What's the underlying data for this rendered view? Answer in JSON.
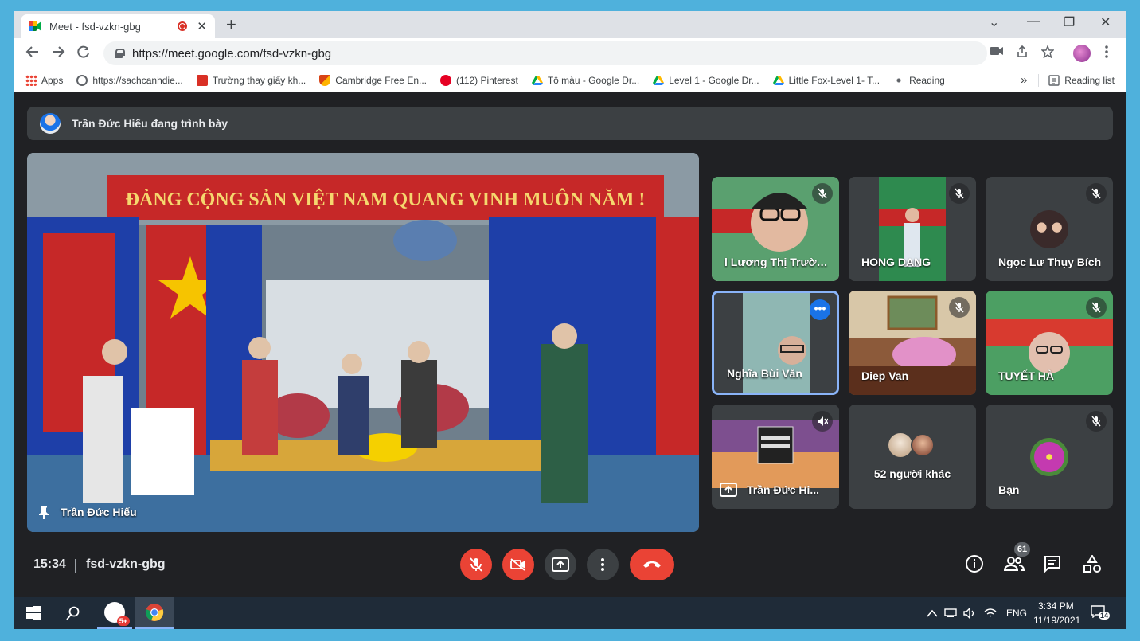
{
  "browser": {
    "tab_title": "Meet - fsd-vzkn-gbg",
    "tab_close": "✕",
    "new_tab": "+",
    "url": "https://meet.google.com/fsd-vzkn-gbg",
    "window_controls": {
      "down": "⌄",
      "minimize": "—",
      "restore": "❐",
      "close": "✕"
    }
  },
  "bookmarks": [
    {
      "label": "Apps",
      "icon": "apps-grid-icon",
      "color": "#ea4335"
    },
    {
      "label": "https://sachcanhdie...",
      "icon": "globe-icon",
      "color": "#5f6368"
    },
    {
      "label": "Trường thay giấy kh...",
      "icon": "school-icon",
      "color": "#d93025"
    },
    {
      "label": "Cambridge Free En...",
      "icon": "cambridge-icon",
      "color": "#d84315"
    },
    {
      "label": "(112) Pinterest",
      "icon": "pinterest-icon",
      "color": "#e60023"
    },
    {
      "label": "Tô màu - Google Dr...",
      "icon": "drive-icon",
      "color": "#1a73e8"
    },
    {
      "label": "Level 1 - Google Dr...",
      "icon": "drive-icon",
      "color": "#1a73e8"
    },
    {
      "label": "Little Fox-Level 1- T...",
      "icon": "drive-icon",
      "color": "#1a73e8"
    },
    {
      "label": "Reading",
      "icon": "reading-icon",
      "color": "#5f6368"
    }
  ],
  "bookmarks_more": "»",
  "reading_list": "Reading list",
  "meet": {
    "presenting_text": "Trần Đức Hiếu đang trình bày",
    "main_label": "Trần Đức Hiếu",
    "video_banner": "ĐẢNG CỘNG SẢN VIỆT NAM QUANG VINH MUÔN NĂM !",
    "tiles": [
      {
        "name": "l Lương Thị Trườn...",
        "muted": true
      },
      {
        "name": "HONG DANG",
        "muted": true
      },
      {
        "name": "Ngọc Lư Thụy Bích",
        "muted": true
      },
      {
        "name": "Nghĩa Bùi Văn",
        "muted": false
      },
      {
        "name": "Diep Van",
        "muted": true
      },
      {
        "name": "TUYẾT HÀ",
        "muted": true
      },
      {
        "name": "Trần Đức Hi...",
        "muted": true
      },
      {
        "name": "52 người khác",
        "muted": false
      },
      {
        "name": "Bạn",
        "muted": true
      }
    ],
    "more_dots": "•••",
    "time": "15:34",
    "meeting_code": "fsd-vzkn-gbg",
    "participants_count": "61"
  },
  "taskbar": {
    "chat_badge": "5+",
    "lang": "ENG",
    "time": "3:34 PM",
    "date": "11/19/2021",
    "notif_count": "14"
  },
  "colors": {
    "meet_bg": "#202124",
    "accent_blue": "#1a73e8",
    "danger_red": "#ea4335"
  }
}
